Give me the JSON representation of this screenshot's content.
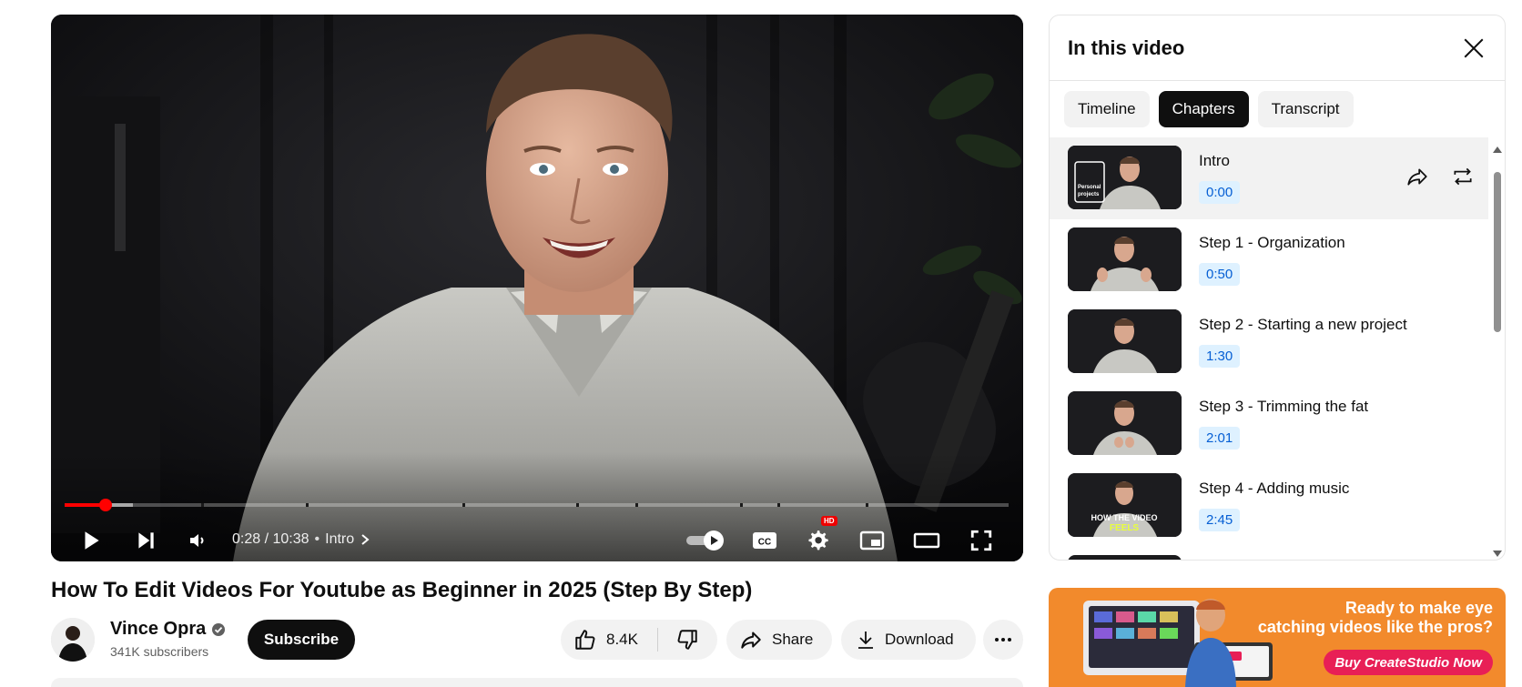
{
  "player": {
    "current_time": "0:28",
    "duration": "10:38",
    "time_display": "0:28 / 10:38",
    "current_chapter": "Intro",
    "hd_badge": "HD",
    "progress_fraction": 0.043
  },
  "video": {
    "title": "How To Edit Videos For Youtube as Beginner in 2025 (Step By Step)"
  },
  "channel": {
    "name": "Vince Opra",
    "subscribers": "341K subscribers",
    "subscribe_label": "Subscribe"
  },
  "actions": {
    "like_count": "8.4K",
    "share_label": "Share",
    "download_label": "Download"
  },
  "panel": {
    "title": "In this video",
    "tabs": [
      {
        "label": "Timeline",
        "active": false
      },
      {
        "label": "Chapters",
        "active": true
      },
      {
        "label": "Transcript",
        "active": false
      }
    ],
    "chapters": [
      {
        "title": "Intro",
        "time": "0:00",
        "thumb_text": "Personal projects"
      },
      {
        "title": "Step 1 - Organization",
        "time": "0:50"
      },
      {
        "title": "Step 2 - Starting a new project",
        "time": "1:30"
      },
      {
        "title": "Step 3 - Trimming the fat",
        "time": "2:01"
      },
      {
        "title": "Step 4 - Adding music",
        "time": "2:45",
        "thumb_text_1": "HOW THE VIDEO",
        "thumb_text_2": "FEELS"
      }
    ]
  },
  "ad": {
    "headline_line1": "Ready to make eye",
    "headline_line2": "catching videos like the pros?",
    "cta": "Buy CreateStudio Now"
  },
  "colors": {
    "accent_red": "#ff0000",
    "chapter_time_bg": "#def1ff",
    "chapter_time_text": "#065fd4",
    "ad_orange": "#f28a2c",
    "ad_cta_pink": "#e81f56"
  }
}
